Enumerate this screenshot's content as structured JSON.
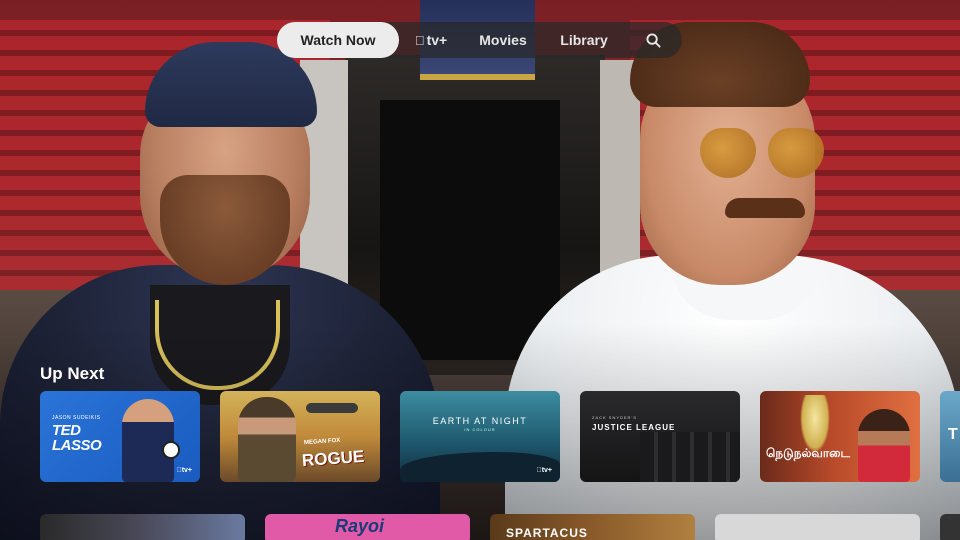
{
  "nav": {
    "items": [
      {
        "label": "Watch Now",
        "active": true
      },
      {
        "label": "tv+",
        "brand_glyph": "apple-logo"
      },
      {
        "label": "Movies"
      },
      {
        "label": "Library"
      },
      {
        "icon": "search-icon"
      }
    ]
  },
  "up_next": {
    "title": "Up Next",
    "tiles": [
      {
        "title": "TED LASSO",
        "presenter": "JASON SUDEIKIS",
        "badge": "tv+"
      },
      {
        "title": "ROGUE",
        "subtitle": "MEGAN FOX"
      },
      {
        "title": "EARTH AT NIGHT",
        "subtitle": "IN COLOUR",
        "badge": "tv+"
      },
      {
        "title": "JUSTICE LEAGUE",
        "subtitle": "ZACK SNYDER'S"
      },
      {
        "title": "நெடுநல்வாடை"
      },
      {
        "title": "T"
      }
    ]
  },
  "row2": {
    "tiles": [
      {
        "title": ""
      },
      {
        "title": "Rayoi"
      },
      {
        "title": "SPARTACUS"
      },
      {
        "title": ""
      },
      {
        "title": ""
      }
    ]
  },
  "colors": {
    "nav_bg": "#282828",
    "nav_active_bg": "#ececec",
    "ted_lasso_blue": "#2a74d8",
    "rayoi_pink": "#e15aa8"
  }
}
